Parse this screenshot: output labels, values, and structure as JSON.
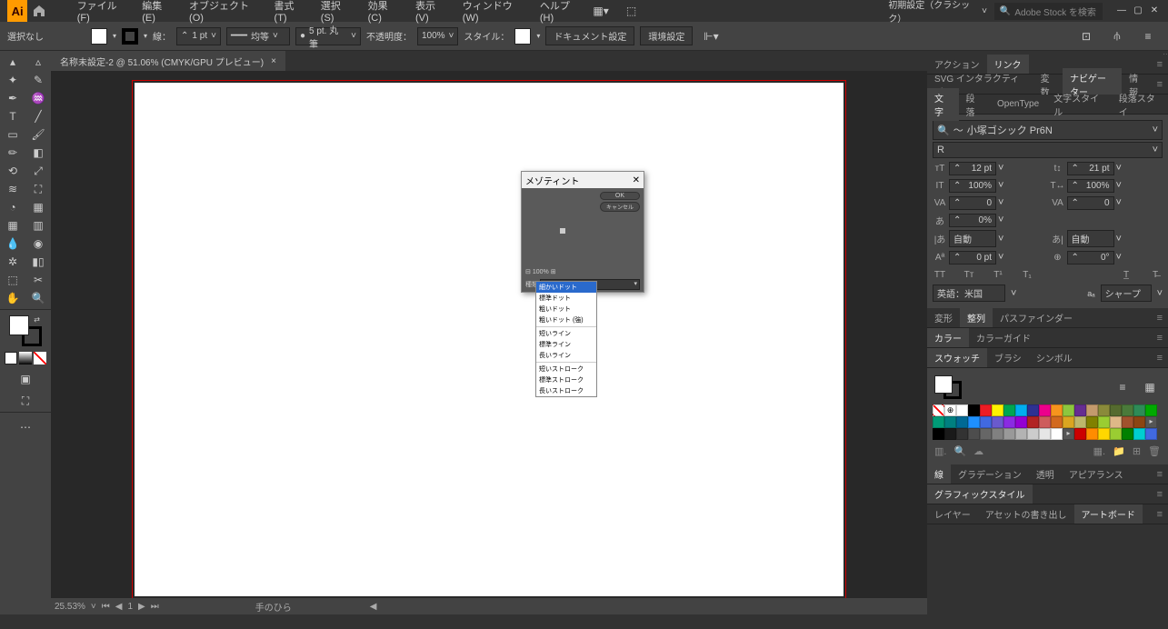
{
  "app": {
    "name": "Ai"
  },
  "menubar": {
    "items": [
      "ファイル(F)",
      "編集(E)",
      "オブジェクト(O)",
      "書式(T)",
      "選択(S)",
      "効果(C)",
      "表示(V)",
      "ウィンドウ(W)",
      "ヘルプ(H)"
    ],
    "workspace": "初期設定（クラシック）",
    "search_placeholder": "Adobe Stock を検索"
  },
  "controlbar": {
    "selection": "選択なし",
    "stroke_label": "線：",
    "stroke_weight": "1 pt",
    "stroke_profile": "均等",
    "brush": "5 pt. 丸筆",
    "opacity_label": "不透明度：",
    "opacity": "100%",
    "style_label": "スタイル：",
    "doc_setup": "ドキュメント設定",
    "prefs": "環境設定"
  },
  "document": {
    "tab_title": "名称未設定-2 @ 51.06% (CMYK/GPU プレビュー)",
    "zoom": "25.53%",
    "page": "1",
    "tool_hint": "手のひら"
  },
  "dialog": {
    "title": "メゾティント",
    "ok": "OK",
    "cancel": "キャンセル",
    "zoom": "100%",
    "type_label": "種類",
    "type_value": "細かいドット",
    "options": [
      "細かいドット",
      "標準ドット",
      "粗いドット",
      "粗いドット (強)",
      "ー",
      "短いライン",
      "標準ライン",
      "長いライン",
      "ー",
      "短いストローク",
      "標準ストローク",
      "長いストローク"
    ]
  },
  "panels": {
    "actions": "アクション",
    "links": "リンク",
    "svg": "SVG インタラクティビティ",
    "vars": "変数",
    "navigator": "ナビゲーター",
    "info": "情報",
    "char": "文字",
    "para": "段落",
    "opentype": "OpenType",
    "char_style": "文字スタイル",
    "para_style": "段落スタイ",
    "font_name": "小塚ゴシック Pr6N",
    "font_style": "R",
    "font_size": "12 pt",
    "leading": "21 pt",
    "hscale": "100%",
    "vscale": "100%",
    "kerning": "0",
    "tracking": "0",
    "tsume": "0%",
    "aki_l": "自動",
    "aki_r": "自動",
    "baseline": "0 pt",
    "rotation": "0°",
    "lang": "英語：米国",
    "aa": "シャープ",
    "transform": "変形",
    "align": "整列",
    "pathfinder": "パスファインダー",
    "color": "カラー",
    "color_guide": "カラーガイド",
    "swatches": "スウォッチ",
    "brushes": "ブラシ",
    "symbols": "シンボル",
    "stroke": "線",
    "gradient": "グラデーション",
    "transparency": "透明",
    "appearance": "アピアランス",
    "graphic_styles": "グラフィックスタイル",
    "layers": "レイヤー",
    "asset_export": "アセットの書き出し",
    "artboards": "アートボード"
  }
}
